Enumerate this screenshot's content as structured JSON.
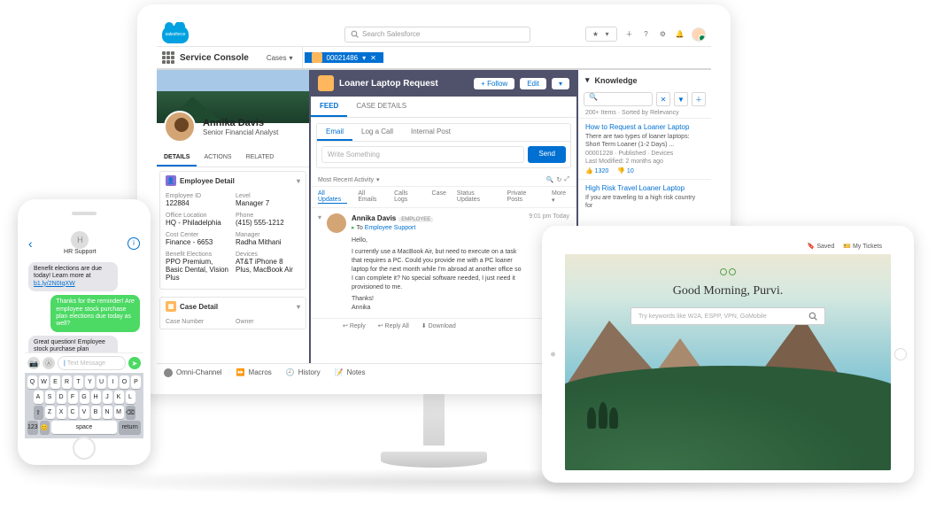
{
  "desktop": {
    "cloud_label": "salesforce",
    "search_placeholder": "Search Salesforce",
    "nav": {
      "app": "Service Console",
      "tab1": "Cases",
      "case_num": "00021486"
    },
    "profile": {
      "name": "Annika Davis",
      "title": "Senior Financial Analyst"
    },
    "sub_tabs": [
      "DETAILS",
      "ACTIONS",
      "RELATED"
    ],
    "emp_card": {
      "title": "Employee Detail",
      "fields": [
        {
          "label": "Employee ID",
          "value": "122884"
        },
        {
          "label": "Level",
          "value": "Manager 7"
        },
        {
          "label": "Office Location",
          "value": "HQ - Philadelphia"
        },
        {
          "label": "Phone",
          "value": "(415) 555-1212"
        },
        {
          "label": "Cost Center",
          "value": "Finance - 6653"
        },
        {
          "label": "Manager",
          "value": "Radha Mithani"
        },
        {
          "label": "Benefit Elections",
          "value": "PPO Premium, Basic Dental, Vision Plus"
        },
        {
          "label": "Devices",
          "value": "AT&T iPhone 8 Plus, MacBook Air"
        }
      ]
    },
    "case_card": {
      "title": "Case Detail",
      "f1": "Case Number",
      "f2": "Owner"
    },
    "mid": {
      "title": "Loaner Laptop Request",
      "follow": "+ Follow",
      "edit": "Edit",
      "tabs": [
        "FEED",
        "CASE DETAILS"
      ],
      "composer_tabs": [
        "Email",
        "Log a Call",
        "Internal Post"
      ],
      "placeholder": "Write Something",
      "send": "Send",
      "recent": "Most Recent Activity",
      "filters": [
        "All Updates",
        "All Emails",
        "Calls Logs",
        "Case",
        "Status Updates",
        "Private Posts",
        "More"
      ],
      "feed": {
        "author": "Annika Davis",
        "badge": "EMPLOYEE",
        "to": "Employee Support",
        "time": "9:01 pm Today",
        "greeting": "Hello,",
        "body": "I currently use a MacBook Air, but need to execute on a task that requires a PC. Could you provide me with a PC loaner laptop for the next month while I'm abroad at another office so I can complete it? No special software needed, I just need it provisioned to me.",
        "thanks": "Thanks!",
        "sign": "Annika",
        "actions": [
          "Reply",
          "Reply All",
          "Download"
        ]
      }
    },
    "knowledge": {
      "title": "Knowledge",
      "meta": "200+ Items · Sorted by Relevancy",
      "item1": {
        "title": "How to Request a Loaner Laptop",
        "snippet": "There are two types of loaner laptops: Short Term Loaner (1-2 Days) ...",
        "sub": "00001228 · Published · Devices",
        "mod": "Last Modified: 2 months ago",
        "s1": "1320",
        "s2": "10"
      },
      "item2": {
        "title": "High Risk Travel Loaner Laptop",
        "snippet": "If you are traveling to a high risk country for"
      }
    },
    "util": {
      "omni": "Omni-Channel",
      "macros": "Macros",
      "history": "History",
      "notes": "Notes"
    }
  },
  "phone": {
    "title": "HR Support",
    "msgs": [
      {
        "dir": "in",
        "text": "Benefit elections are due today! Learn more at ",
        "link": "b1.ly/2N0IqXW"
      },
      {
        "dir": "out",
        "text": "Thanks for the reminder! Are employee stock purchase plan elections due today as well?"
      },
      {
        "dir": "in",
        "text": "Great question! Employee stock purchase plan elections are due end of next week."
      }
    ],
    "compose_placeholder": "Text Message",
    "kb": {
      "r1": [
        "Q",
        "W",
        "E",
        "R",
        "T",
        "Y",
        "U",
        "I",
        "O",
        "P"
      ],
      "r2": [
        "A",
        "S",
        "D",
        "F",
        "G",
        "H",
        "J",
        "K",
        "L"
      ],
      "r3": [
        "Z",
        "X",
        "C",
        "V",
        "B",
        "N",
        "M"
      ],
      "num": "123",
      "space": "space",
      "ret": "return"
    }
  },
  "tablet": {
    "top": [
      "Saved",
      "My Tickets"
    ],
    "greeting": "Good Morning, Purvi.",
    "search_placeholder": "Try keywords like W2A, ESPP, VPN, GoMobile"
  }
}
